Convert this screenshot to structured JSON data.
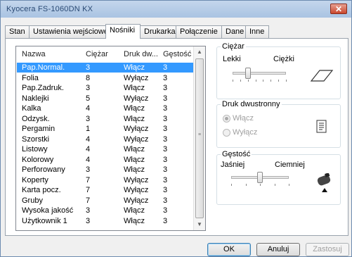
{
  "window": {
    "title": "Kyocera FS-1060DN KX"
  },
  "tabs": [
    "Stan",
    "Ustawienia wejściowe",
    "Nośniki",
    "Drukarka",
    "Połączenie",
    "Dane",
    "Inne"
  ],
  "media": {
    "columns": [
      "Nazwa",
      "Ciężar",
      "Druk dw...",
      "Gęstość"
    ],
    "rows": [
      [
        "Pap.Normal.",
        "3",
        "Włącz",
        "3"
      ],
      [
        "Folia",
        "8",
        "Wyłącz",
        "3"
      ],
      [
        "Pap.Zadruk.",
        "3",
        "Włącz",
        "3"
      ],
      [
        "Naklejki",
        "5",
        "Wyłącz",
        "3"
      ],
      [
        "Kalka",
        "4",
        "Włącz",
        "3"
      ],
      [
        "Odzysk.",
        "3",
        "Włącz",
        "3"
      ],
      [
        "Pergamin",
        "1",
        "Wyłącz",
        "3"
      ],
      [
        "Szorstki",
        "4",
        "Wyłącz",
        "3"
      ],
      [
        "Listowy",
        "4",
        "Włącz",
        "3"
      ],
      [
        "Kolorowy",
        "4",
        "Włącz",
        "3"
      ],
      [
        "Perforowany",
        "3",
        "Włącz",
        "3"
      ],
      [
        "Koperty",
        "7",
        "Wyłącz",
        "3"
      ],
      [
        "Karta pocz.",
        "7",
        "Wyłącz",
        "3"
      ],
      [
        "Gruby",
        "7",
        "Wyłącz",
        "3"
      ],
      [
        "Wysoka jakość",
        "3",
        "Włącz",
        "3"
      ],
      [
        "Użytkownik 1",
        "3",
        "Włącz",
        "3"
      ]
    ],
    "selected_index": 0
  },
  "weight": {
    "title": "Ciężar",
    "min_label": "Lekki",
    "max_label": "Ciężki",
    "level": 3,
    "levels": 8
  },
  "duplex": {
    "title": "Druk dwustronny",
    "on_label": "Włącz",
    "off_label": "Wyłącz",
    "selected": "on"
  },
  "density": {
    "title": "Gęstość",
    "min_label": "Jaśniej",
    "max_label": "Ciemniej",
    "level": 3,
    "levels": 5
  },
  "buttons": {
    "ok": "OK",
    "cancel": "Anuluj",
    "apply": "Zastosuj"
  },
  "colors": {
    "selection": "#3399ff",
    "title_text": "#2a4a74"
  },
  "icons": {
    "close": "close-icon",
    "weight": "paper-sheet-icon",
    "duplex": "duplex-document-icon",
    "density": "toner-cartridge-icon"
  }
}
